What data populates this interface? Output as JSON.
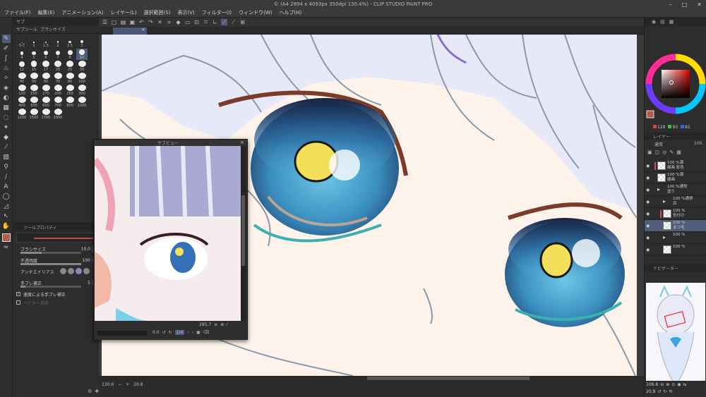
{
  "window": {
    "title": "© (A4 2894 x 4093px 350dpi 130.4%) - CLIP STUDIO PAINT PRO",
    "controls": [
      "–",
      "□",
      "✕"
    ]
  },
  "menu": [
    "ファイル(F)",
    "編集(E)",
    "アニメーション(A)",
    "レイヤー(L)",
    "選択範囲(S)",
    "表示(V)",
    "フィルター(I)",
    "ウィンドウ(W)",
    "ヘルプ(H)"
  ],
  "subtool_panel": {
    "tab_labels": [
      "サブツール",
      "ブラシサイズ"
    ],
    "header_label": "サブ",
    "brush_sizes": [
      "0.7",
      "1",
      "1.5",
      "2",
      "2.5",
      "3",
      "4",
      "5",
      "6",
      "7",
      "8",
      "10",
      "12",
      "15",
      "17",
      "20",
      "25",
      "30",
      "40",
      "50",
      "60",
      "70",
      "80",
      "100",
      "120",
      "150",
      "170",
      "200",
      "250",
      "300",
      "400",
      "500",
      "600",
      "700",
      "800",
      "1000",
      "1200",
      "1500",
      "1700",
      "2000"
    ],
    "selected_size": "10"
  },
  "tool_property": {
    "header": "ツールプロパティ",
    "brush_size": {
      "label": "ブラシサイズ",
      "value": "10.0",
      "level": 0.35
    },
    "opacity": {
      "label": "不透明度",
      "value": "100",
      "level": 1.0
    },
    "antialias": {
      "label": "アンチエイリアス"
    },
    "stabilization": {
      "label": "手ブレ補正",
      "value": "5",
      "level": 0.08
    },
    "speed_check": "速度による手ブレ補正",
    "vector_erase": "ベクター消去"
  },
  "preview_window": {
    "title": "サブビュー",
    "zoom": "285.7",
    "angle": "0.0",
    "page": "1/4"
  },
  "status": {
    "zoom": "130.6",
    "angle": "20.8"
  },
  "color_panel": {
    "r": "129",
    "g": "93",
    "b": "81",
    "main_color": "#b45a48"
  },
  "layer_panel": {
    "header": "レイヤー",
    "blend_mode": "通常",
    "opacity": "100",
    "layers": [
      {
        "name_top": "100 %潮",
        "name_bottom": "線画 影色",
        "kind": "raster",
        "selected": false,
        "marked": true,
        "indent": 0
      },
      {
        "name_top": "100 %潮",
        "name_bottom": "線画",
        "kind": "raster",
        "selected": false,
        "marked": false,
        "indent": 0
      },
      {
        "name_top": "100 %通常",
        "name_bottom": "塗り",
        "kind": "folder",
        "selected": false,
        "marked": false,
        "indent": 0
      },
      {
        "name_top": "100 %通常",
        "name_bottom": "目",
        "kind": "folder",
        "selected": false,
        "marked": false,
        "indent": 1
      },
      {
        "name_top": "100 %",
        "name_bottom": "色付け",
        "kind": "raster",
        "selected": false,
        "marked": true,
        "indent": 1
      },
      {
        "name_top": "100 %",
        "name_bottom": "まつ毛",
        "kind": "raster",
        "selected": true,
        "marked": false,
        "indent": 1
      },
      {
        "name_top": "100 %",
        "name_bottom": "",
        "kind": "folder",
        "selected": false,
        "marked": false,
        "indent": 1
      },
      {
        "name_top": "100 %",
        "name_bottom": "",
        "kind": "raster",
        "selected": false,
        "marked": false,
        "indent": 1
      }
    ]
  },
  "navigator": {
    "header": "ナビゲーター",
    "zoom": "106.8",
    "angle": "20.8"
  }
}
